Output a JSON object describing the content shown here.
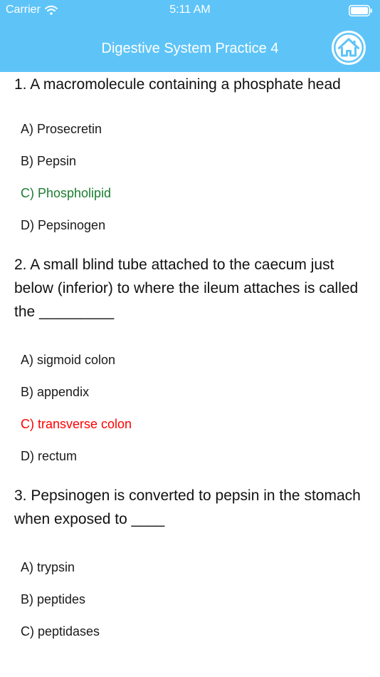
{
  "status_bar": {
    "carrier": "Carrier",
    "time": "5:11 AM"
  },
  "nav": {
    "title": "Digestive System Practice 4",
    "home_icon": "home-icon"
  },
  "colors": {
    "header_bg": "#5ec4f8",
    "correct": "#1b7d2f",
    "wrong": "#ff0000",
    "text": "#111111"
  },
  "questions": [
    {
      "text": "1. A macromolecule containing a phosphate head",
      "options": [
        {
          "label": "A) Prosecretin",
          "state": "default"
        },
        {
          "label": "B) Pepsin",
          "state": "default"
        },
        {
          "label": "C) Phospholipid",
          "state": "correct"
        },
        {
          "label": "D) Pepsinogen",
          "state": "default"
        }
      ]
    },
    {
      "text": "2. A small blind tube attached to the caecum just below (inferior) to where the ileum attaches is called the _________",
      "options": [
        {
          "label": "A) sigmoid colon",
          "state": "default"
        },
        {
          "label": "B) appendix",
          "state": "default"
        },
        {
          "label": "C) transverse colon",
          "state": "wrong"
        },
        {
          "label": "D) rectum",
          "state": "default"
        }
      ]
    },
    {
      "text": "3. Pepsinogen is converted to pepsin in the stomach when exposed to ____",
      "options": [
        {
          "label": "A) trypsin",
          "state": "default"
        },
        {
          "label": "B) peptides",
          "state": "default"
        },
        {
          "label": "C) peptidases",
          "state": "default"
        }
      ]
    }
  ]
}
